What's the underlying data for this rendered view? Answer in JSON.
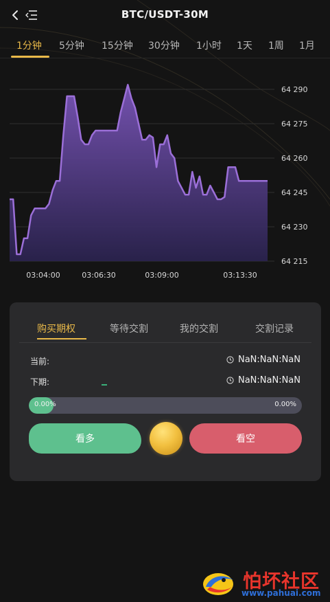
{
  "header": {
    "title": "BTC/USDT-30M"
  },
  "period_tabs": [
    {
      "label": "1分钟",
      "active": true
    },
    {
      "label": "5分钟",
      "active": false
    },
    {
      "label": "15分钟",
      "active": false
    },
    {
      "label": "30分钟",
      "active": false
    },
    {
      "label": "1小时",
      "active": false
    },
    {
      "label": "1天",
      "active": false
    },
    {
      "label": "1周",
      "active": false
    },
    {
      "label": "1月",
      "active": false
    }
  ],
  "chart_data": {
    "type": "area",
    "title": "",
    "xlabel": "",
    "ylabel": "",
    "y_ticks": [
      "64 290",
      "64 275",
      "64 260",
      "64 245",
      "64 230",
      "64 215"
    ],
    "x_ticks": [
      "03:04:00",
      "03:06:30",
      "03:09:00",
      "03:13:30"
    ],
    "ylim": [
      64215,
      64290
    ],
    "line_color": "#9b6fd8",
    "grid": true,
    "series": [
      {
        "x": [
          0,
          1,
          2,
          3,
          4,
          5,
          6,
          7,
          8,
          9,
          10,
          11,
          12,
          13,
          14,
          15,
          16,
          17,
          18,
          19,
          20,
          21,
          22,
          23,
          24,
          25,
          26,
          27,
          28,
          29,
          30,
          31,
          32,
          33,
          34,
          35,
          36,
          37,
          38,
          39,
          40,
          41,
          42,
          43,
          44,
          45,
          46,
          47,
          48,
          49,
          50,
          51,
          52,
          53,
          54,
          55,
          56,
          57,
          58,
          59,
          60,
          61,
          62,
          63,
          64,
          65,
          66,
          67,
          68,
          69,
          70,
          71,
          72
        ],
        "values": [
          64242,
          64242,
          64218,
          64218,
          64225,
          64225,
          64235,
          64238,
          64238,
          64238,
          64238,
          64240,
          64246,
          64250,
          64250,
          64270,
          64287,
          64287,
          64287,
          64278,
          64268,
          64266,
          64266,
          64270,
          64272,
          64272,
          64272,
          64272,
          64272,
          64272,
          64272,
          64280,
          64286,
          64292,
          64286,
          64282,
          64275,
          64268,
          64268,
          64270,
          64269,
          64256,
          64266,
          64266,
          64270,
          64262,
          64260,
          64250,
          64247,
          64244,
          64244,
          64254,
          64247,
          64252,
          64244,
          64244,
          64248,
          64245,
          64242,
          64242,
          64243,
          64256,
          64256,
          64256,
          64250,
          64250,
          64250,
          64250,
          64250,
          64250,
          64250,
          64250,
          64250
        ]
      }
    ]
  },
  "panel": {
    "tabs": [
      {
        "label": "购买期权",
        "active": true
      },
      {
        "label": "等待交割",
        "active": false
      },
      {
        "label": "我的交割",
        "active": false
      },
      {
        "label": "交割记录",
        "active": false
      }
    ],
    "current_label": "当前:",
    "current_value": "NaN:NaN:NaN",
    "next_label": "下期:",
    "next_value": "NaN:NaN:NaN",
    "progress_left": "0.00%",
    "progress_right": "0.00%",
    "progress_value": 0.0,
    "buy_up_label": "看多",
    "buy_down_label": "看空"
  },
  "colors": {
    "accent": "#e9b949",
    "up": "#5ec08e",
    "down": "#d85e6c",
    "panel": "#2a2a2c",
    "background": "#141414"
  },
  "watermark": {
    "title": "怕坏社区",
    "url": "www.pahuai.com"
  }
}
